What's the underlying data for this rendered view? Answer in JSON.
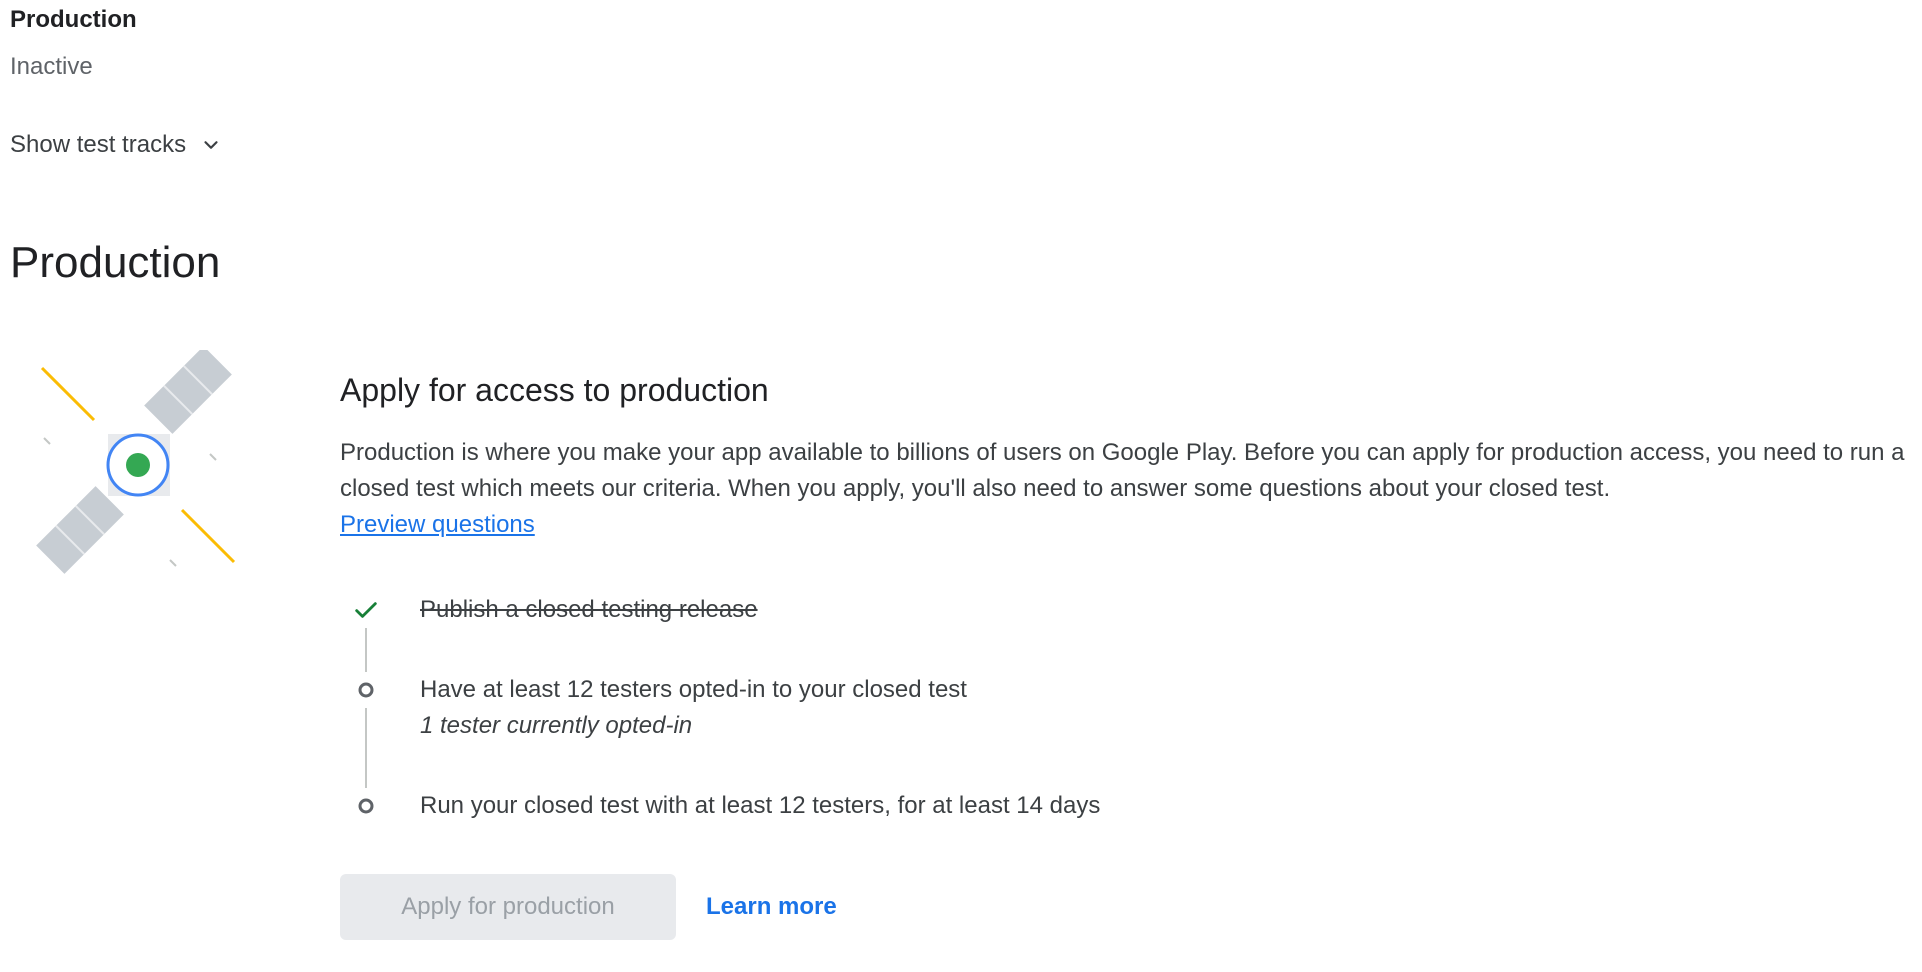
{
  "track_summary": {
    "label": "Production",
    "status": "Inactive",
    "show_tracks_label": "Show test tracks"
  },
  "section": {
    "title": "Production"
  },
  "apply_card": {
    "heading": "Apply for access to production",
    "description": "Production is where you make your app available to billions of users on Google Play. Before you can apply for production access, you need to run a closed test which meets our criteria. When you apply, you'll also need to answer some questions about your closed test.",
    "preview_link": "Preview questions",
    "steps": [
      {
        "label": "Publish a closed testing release",
        "done": true
      },
      {
        "label": "Have at least 12 testers opted-in to your closed test",
        "sub": "1 tester currently opted-in",
        "done": false
      },
      {
        "label": "Run your closed test with at least 12 testers, for at least 14 days",
        "done": false
      }
    ],
    "apply_button": "Apply for production",
    "learn_more": "Learn more"
  },
  "colors": {
    "link": "#1a73e8",
    "check": "#188038",
    "satellite_dot": "#34a853",
    "satellite_ring": "#4285f4",
    "beam": "#fbbc04"
  }
}
